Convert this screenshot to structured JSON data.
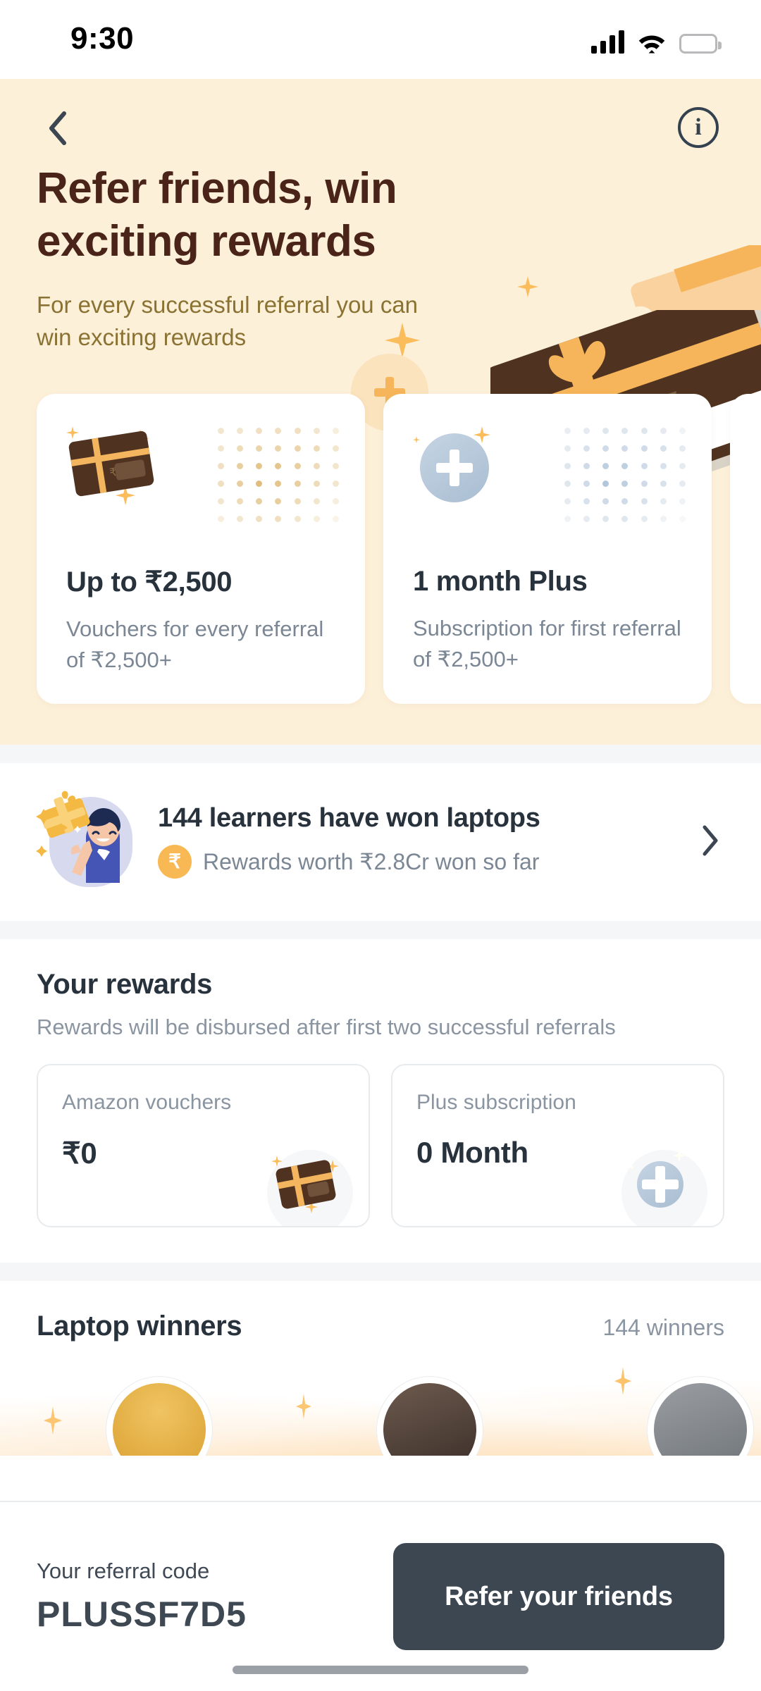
{
  "status_bar": {
    "time": "9:30",
    "signal_icon": "signal-bars-icon",
    "wifi_icon": "wifi-icon",
    "battery_icon": "battery-icon"
  },
  "hero": {
    "back_icon": "chevron-left-icon",
    "info_icon": "info-circle-icon",
    "title": "Refer friends, win exciting rewards",
    "subtitle": "For every successful referral you can win exciting rewards",
    "background_color": "#fdf0d9",
    "title_color": "#4a2319",
    "subtitle_color": "#8a7233",
    "illustration": "gift-card-sparkles-illustration"
  },
  "benefit_cards": [
    {
      "icon": "gift-card-icon",
      "title": "Up to ₹2,500",
      "description": "Vouchers for every referral of ₹2,500+",
      "dot_color": "#f0dfc0"
    },
    {
      "icon": "plus-subscription-icon",
      "title": "1 month Plus",
      "description": "Subscription for first referral of ₹2,500+",
      "dot_color": "#dbe4ed"
    },
    {
      "icon": "",
      "title": "",
      "description": "",
      "dot_color": "#e8eaee"
    }
  ],
  "winners_banner": {
    "avatar_icon": "person-with-gift-avatar",
    "title": "144 learners have won laptops",
    "coin_icon": "rupee-coin-icon",
    "coin_symbol": "₹",
    "subtitle": "Rewards worth ₹2.8Cr won so far",
    "chevron_icon": "chevron-right-icon"
  },
  "your_rewards": {
    "title": "Your rewards",
    "subtitle": "Rewards will be disbursed after first two successful referrals",
    "items": [
      {
        "label": "Amazon vouchers",
        "value": "₹0",
        "badge_icon": "gift-card-icon"
      },
      {
        "label": "Plus subscription",
        "value": "0 Month",
        "badge_icon": "plus-subscription-icon"
      }
    ]
  },
  "laptop_winners": {
    "title": "Laptop winners",
    "count_label": "144 winners",
    "avatars": [
      {
        "name": "winner-avatar-1",
        "color": "#e7b24a"
      },
      {
        "name": "winner-avatar-2",
        "color": "#6d5a4e"
      },
      {
        "name": "winner-avatar-3",
        "color": "#8b8f94"
      }
    ]
  },
  "bottom_bar": {
    "code_label": "Your referral code",
    "code_value": "PLUSSF7D5",
    "cta_label": "Refer your friends",
    "cta_color": "#3c4752"
  }
}
